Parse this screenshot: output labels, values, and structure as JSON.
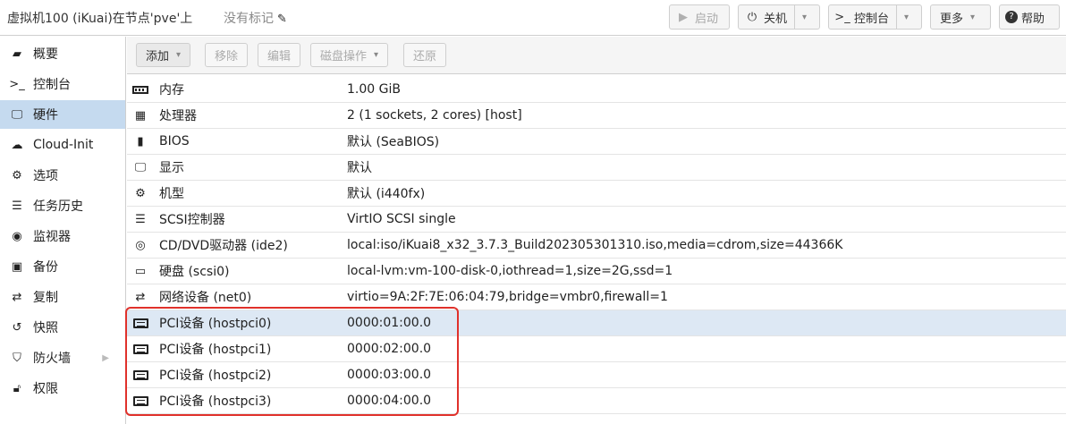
{
  "topbar": {
    "vm_title": "虚拟机100 (iKuai)在节点'pve'上",
    "tags_label": "没有标记",
    "buttons": {
      "start": "启动",
      "shutdown": "关机",
      "console": "控制台",
      "more": "更多",
      "help": "帮助"
    }
  },
  "sidebar": {
    "items": [
      {
        "label": "概要",
        "icon": "book-icon"
      },
      {
        "label": "控制台",
        "icon": "terminal-icon"
      },
      {
        "label": "硬件",
        "icon": "desktop-icon",
        "active": true
      },
      {
        "label": "Cloud-Init",
        "icon": "cloud-icon"
      },
      {
        "label": "选项",
        "icon": "gear-icon"
      },
      {
        "label": "任务历史",
        "icon": "list-icon"
      },
      {
        "label": "监视器",
        "icon": "eye-icon"
      },
      {
        "label": "备份",
        "icon": "floppy-icon"
      },
      {
        "label": "复制",
        "icon": "retweet-icon"
      },
      {
        "label": "快照",
        "icon": "history-icon"
      },
      {
        "label": "防火墙",
        "icon": "shield-icon",
        "expandable": true
      },
      {
        "label": "权限",
        "icon": "unlock-icon"
      }
    ]
  },
  "toolbar": {
    "add": "添加",
    "remove": "移除",
    "edit": "编辑",
    "disk_action": "磁盘操作",
    "revert": "还原"
  },
  "hardware": [
    {
      "name": "内存",
      "value": "1.00 GiB",
      "icon": "memory-icon"
    },
    {
      "name": "处理器",
      "value": "2 (1 sockets, 2 cores) [host]",
      "icon": "cpu-icon"
    },
    {
      "name": "BIOS",
      "value": "默认 (SeaBIOS)",
      "icon": "microchip-icon"
    },
    {
      "name": "显示",
      "value": "默认",
      "icon": "desktop-icon"
    },
    {
      "name": "机型",
      "value": "默认 (i440fx)",
      "icon": "cogs-icon"
    },
    {
      "name": "SCSI控制器",
      "value": "VirtIO SCSI single",
      "icon": "database-icon"
    },
    {
      "name": "CD/DVD驱动器 (ide2)",
      "value": "local:iso/iKuai8_x32_3.7.3_Build202305301310.iso,media=cdrom,size=44366K",
      "icon": "cdrom-icon"
    },
    {
      "name": "硬盘 (scsi0)",
      "value": "local-lvm:vm-100-disk-0,iothread=1,size=2G,ssd=1",
      "icon": "hdd-icon"
    },
    {
      "name": "网络设备 (net0)",
      "value": "virtio=9A:2F:7E:06:04:79,bridge=vmbr0,firewall=1",
      "icon": "exchange-icon"
    },
    {
      "name": "PCI设备 (hostpci0)",
      "value": "0000:01:00.0",
      "icon": "pci-card-icon",
      "selected": true
    },
    {
      "name": "PCI设备 (hostpci1)",
      "value": "0000:02:00.0",
      "icon": "pci-card-icon"
    },
    {
      "name": "PCI设备 (hostpci2)",
      "value": "0000:03:00.0",
      "icon": "pci-card-icon"
    },
    {
      "name": "PCI设备 (hostpci3)",
      "value": "0000:04:00.0",
      "icon": "pci-card-icon"
    }
  ],
  "colors": {
    "selected_nav": "#c5daef",
    "selected_row": "#dde8f4",
    "annotation_border": "#e0312b"
  }
}
